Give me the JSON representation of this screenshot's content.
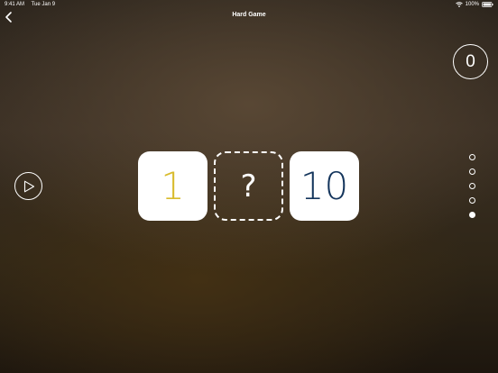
{
  "status_bar": {
    "time": "9:41 AM",
    "date": "Tue Jan 9",
    "battery": "100%"
  },
  "nav": {
    "title": "Hard Game"
  },
  "score": {
    "value": "0"
  },
  "puzzle": {
    "left_value": "1",
    "middle_value": "?",
    "right_value": "10"
  },
  "progress": {
    "total": 5,
    "current": 5
  },
  "colors": {
    "left_number": "#d8bb2c",
    "right_number": "#14355c"
  },
  "icons": {
    "back": "chevron-left-icon",
    "play": "play-icon",
    "wifi": "wifi-icon",
    "battery": "battery-icon"
  }
}
